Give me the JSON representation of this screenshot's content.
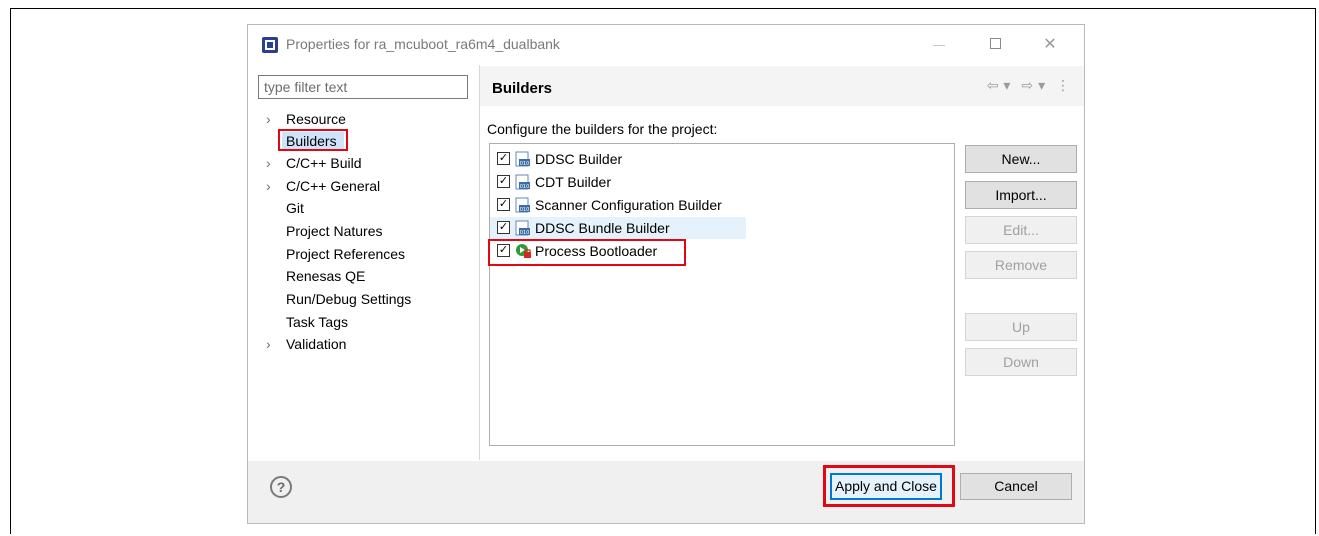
{
  "window": {
    "title": "Properties for ra_mcuboot_ra6m4_dualbank",
    "close_glyph": "✕"
  },
  "filter": {
    "placeholder": "type filter text"
  },
  "tree": {
    "items": [
      {
        "label": "Resource",
        "expandable": true
      },
      {
        "label": "Builders",
        "expandable": false,
        "selected": true
      },
      {
        "label": "C/C++ Build",
        "expandable": true
      },
      {
        "label": "C/C++ General",
        "expandable": true
      },
      {
        "label": "Git",
        "expandable": false
      },
      {
        "label": "Project Natures",
        "expandable": false
      },
      {
        "label": "Project References",
        "expandable": false
      },
      {
        "label": "Renesas QE",
        "expandable": false
      },
      {
        "label": "Run/Debug Settings",
        "expandable": false
      },
      {
        "label": "Task Tags",
        "expandable": false
      },
      {
        "label": "Validation",
        "expandable": true
      }
    ],
    "chevron_glyph": "›"
  },
  "page": {
    "title": "Builders",
    "description": "Configure the builders for the project:",
    "nav": {
      "back": "⇦",
      "dropdown": "▾",
      "forward": "⇨",
      "menu": "⋮"
    }
  },
  "builders": [
    {
      "label": "DDSC Builder",
      "checked": true,
      "icon": "builder-binary-icon"
    },
    {
      "label": "CDT Builder",
      "checked": true,
      "icon": "builder-binary-icon"
    },
    {
      "label": "Scanner Configuration Builder",
      "checked": true,
      "icon": "builder-binary-icon"
    },
    {
      "label": "DDSC Bundle Builder",
      "checked": true,
      "icon": "builder-binary-icon"
    },
    {
      "label": "Process Bootloader",
      "checked": true,
      "icon": "external-tool-icon"
    }
  ],
  "buttons": {
    "new": "New...",
    "import": "Import...",
    "edit": "Edit...",
    "remove": "Remove",
    "up": "Up",
    "down": "Down"
  },
  "footer": {
    "help": "?",
    "apply_close": "Apply and Close",
    "cancel": "Cancel"
  },
  "colors": {
    "highlight_red": "#e30613",
    "selection_blue": "#cfe3fb",
    "focus_blue": "#0078d7"
  },
  "check_glyph": "✓"
}
